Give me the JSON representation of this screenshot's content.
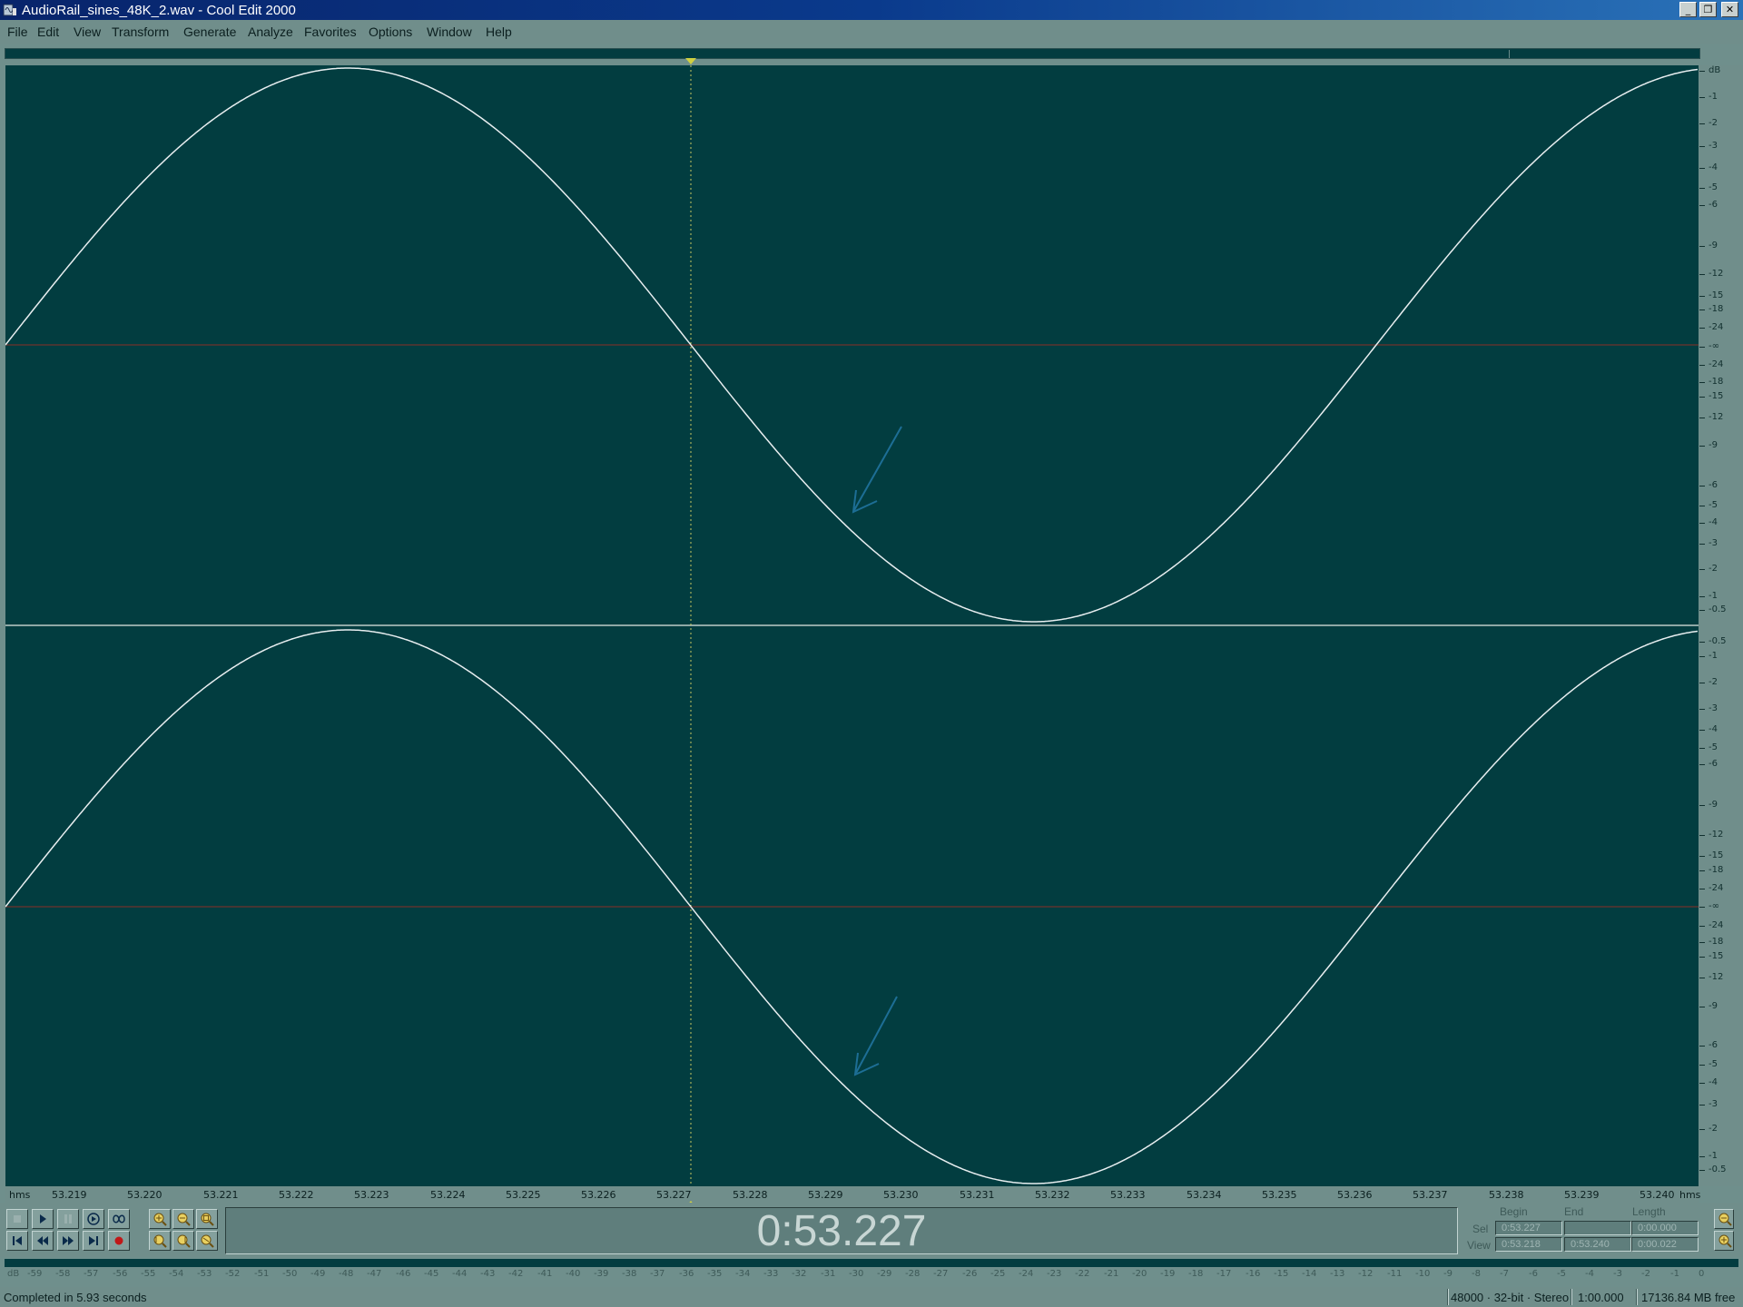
{
  "window": {
    "title": "AudioRail_sines_48K_2.wav - Cool Edit 2000",
    "minimize_glyph": "_",
    "restore_glyph": "❐",
    "close_glyph": "✕"
  },
  "menu": [
    "File",
    "Edit",
    "View",
    "Transform",
    "Generate",
    "Analyze",
    "Favorites",
    "Options",
    "Window",
    "Help"
  ],
  "waveform": {
    "channels": 2,
    "wave_color": "#e8eef0",
    "background": "#023d40",
    "centerline_color": "#8a2f26",
    "cursor_color": "#c8c860",
    "arrow_color": "#1d6e95",
    "db_scale_top": [
      "dB",
      "-1",
      "-2",
      "-3",
      "-4",
      "-5",
      "-6",
      "-9",
      "-12",
      "-15",
      "-18",
      "-24",
      "-∞",
      "-24",
      "-18",
      "-15",
      "-12",
      "-9",
      "-6",
      "-5",
      "-4",
      "-3",
      "-2",
      "-1",
      "-0.5"
    ],
    "db_scale_bottom": [
      "-0.5",
      "-1",
      "-2",
      "-3",
      "-4",
      "-5",
      "-6",
      "-9",
      "-12",
      "-15",
      "-18",
      "-24",
      "-∞",
      "-24",
      "-18",
      "-15",
      "-12",
      "-9",
      "-6",
      "-5",
      "-4",
      "-3",
      "-2",
      "-1",
      "-0.5"
    ]
  },
  "ruler": {
    "unit_left": "hms",
    "unit_right": "hms",
    "labels": [
      "53.219",
      "53.220",
      "53.221",
      "53.222",
      "53.223",
      "53.224",
      "53.225",
      "53.226",
      "53.227",
      "53.228",
      "53.229",
      "53.230",
      "53.231",
      "53.232",
      "53.233",
      "53.234",
      "53.235",
      "53.236",
      "53.237",
      "53.238",
      "53.239",
      "53.240"
    ]
  },
  "transport": {
    "time": "0:53.227",
    "buttons": [
      "stop",
      "play",
      "pause",
      "play-to-end",
      "loop",
      "go-to-start",
      "rewind",
      "fast-forward",
      "go-to-end",
      "record"
    ],
    "zoom_buttons": [
      "zoom-in-horizontal",
      "zoom-out-horizontal",
      "zoom-full",
      "zoom-to-left",
      "zoom-to-right",
      "zoom-selection"
    ]
  },
  "selection": {
    "header_begin": "Begin",
    "header_end": "End",
    "header_length": "Length",
    "sel_label": "Sel",
    "view_label": "View",
    "sel_begin": "0:53.227",
    "sel_end": "",
    "sel_length": "0:00.000",
    "view_begin": "0:53.218",
    "view_end": "0:53.240",
    "view_length": "0:00.022"
  },
  "meter": {
    "unit": "dB",
    "labels": [
      "-59",
      "-58",
      "-57",
      "-56",
      "-55",
      "-54",
      "-53",
      "-52",
      "-51",
      "-50",
      "-49",
      "-48",
      "-47",
      "-46",
      "-45",
      "-44",
      "-43",
      "-42",
      "-41",
      "-40",
      "-39",
      "-38",
      "-37",
      "-36",
      "-35",
      "-34",
      "-33",
      "-32",
      "-31",
      "-30",
      "-29",
      "-28",
      "-27",
      "-26",
      "-25",
      "-24",
      "-23",
      "-22",
      "-21",
      "-20",
      "-19",
      "-18",
      "-17",
      "-16",
      "-15",
      "-14",
      "-13",
      "-12",
      "-11",
      "-10",
      "-9",
      "-8",
      "-7",
      "-6",
      "-5",
      "-4",
      "-3",
      "-2",
      "-1",
      "0"
    ]
  },
  "status": {
    "message": "Completed in 5.93 seconds",
    "format": "48000 · 32-bit · Stereo",
    "zoom": "1:00.000",
    "free": "17136.84 MB free"
  }
}
